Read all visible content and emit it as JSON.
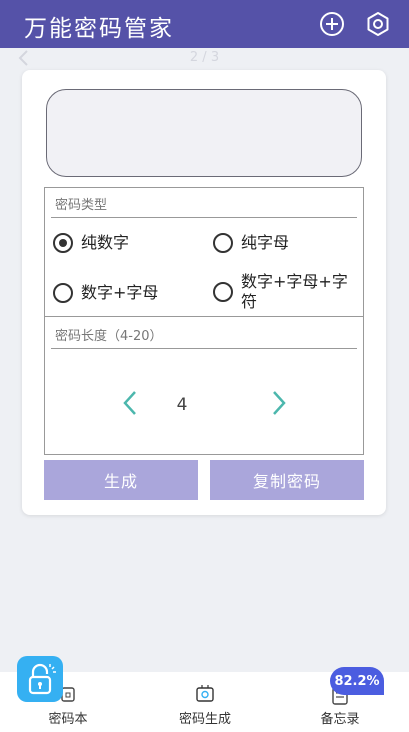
{
  "app": {
    "title": "万能密码管家",
    "icons": {
      "add": "add-circle-icon",
      "settings": "gear-icon",
      "back": "chevron-left-icon"
    }
  },
  "pager": {
    "indicator": "2 / 3"
  },
  "generator": {
    "password_display": "",
    "type_section": {
      "label": "密码类型",
      "options": [
        {
          "label": "纯数字",
          "selected": true
        },
        {
          "label": "纯字母",
          "selected": false
        },
        {
          "label": "数字+字母",
          "selected": false
        },
        {
          "label": "数字+字母+字符",
          "selected": false
        }
      ]
    },
    "length_section": {
      "label": "密码长度（4-20）",
      "value": "4"
    },
    "buttons": {
      "generate": "生成",
      "copy": "复制密码"
    }
  },
  "bottom_nav": {
    "items": [
      {
        "label": "密码本",
        "icon": "lock-icon"
      },
      {
        "label": "密码生成",
        "icon": "password-generator-icon",
        "active": true
      },
      {
        "label": "备忘录",
        "icon": "memo-icon"
      }
    ]
  },
  "overlay_badge": {
    "text": "82.2%"
  },
  "colors": {
    "appbar": "#5552a8",
    "button": "#aaa6db",
    "chevron": "#4cb7ad",
    "lock_tile": "#35b0f2",
    "badge": "#4b5de0"
  }
}
